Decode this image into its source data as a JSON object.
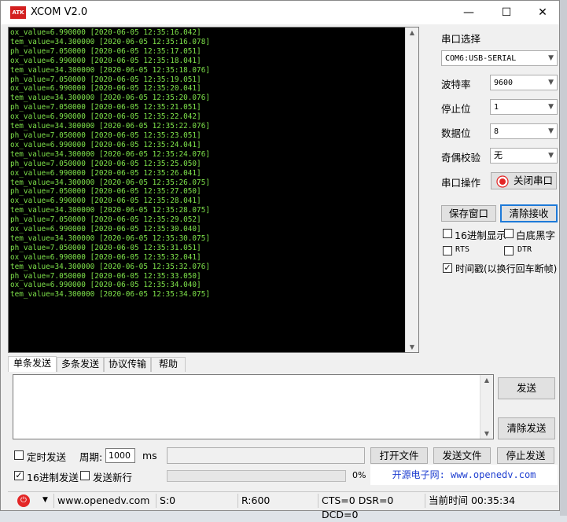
{
  "window": {
    "app_icon_text": "ATK",
    "title": "XCOM V2.0",
    "minimize_glyph": "—",
    "maximize_glyph": "☐",
    "close_glyph": "✕"
  },
  "terminal": {
    "lines": [
      "ox_value=6.990000 [2020-06-05 12:35:16.042]",
      "tem_value=34.300000 [2020-06-05 12:35:16.078]",
      "ph_value=7.050000 [2020-06-05 12:35:17.051]",
      "ox_value=6.990000 [2020-06-05 12:35:18.041]",
      "tem_value=34.300000 [2020-06-05 12:35:18.076]",
      "ph_value=7.050000 [2020-06-05 12:35:19.051]",
      "ox_value=6.990000 [2020-06-05 12:35:20.041]",
      "tem_value=34.300000 [2020-06-05 12:35:20.076]",
      "ph_value=7.050000 [2020-06-05 12:35:21.051]",
      "ox_value=6.990000 [2020-06-05 12:35:22.042]",
      "tem_value=34.300000 [2020-06-05 12:35:22.076]",
      "ph_value=7.050000 [2020-06-05 12:35:23.051]",
      "ox_value=6.990000 [2020-06-05 12:35:24.041]",
      "tem_value=34.300000 [2020-06-05 12:35:24.076]",
      "ph_value=7.050000 [2020-06-05 12:35:25.050]",
      "ox_value=6.990000 [2020-06-05 12:35:26.041]",
      "tem_value=34.300000 [2020-06-05 12:35:26.075]",
      "ph_value=7.050000 [2020-06-05 12:35:27.050]",
      "ox_value=6.990000 [2020-06-05 12:35:28.041]",
      "tem_value=34.300000 [2020-06-05 12:35:28.075]",
      "ph_value=7.050000 [2020-06-05 12:35:29.052]",
      "ox_value=6.990000 [2020-06-05 12:35:30.040]",
      "tem_value=34.300000 [2020-06-05 12:35:30.075]",
      "ph_value=7.050000 [2020-06-05 12:35:31.051]",
      "ox_value=6.990000 [2020-06-05 12:35:32.041]",
      "tem_value=34.300000 [2020-06-05 12:35:32.076]",
      "ph_value=7.050000 [2020-06-05 12:35:33.050]",
      "ox_value=6.990000 [2020-06-05 12:35:34.040]",
      "tem_value=34.300000 [2020-06-05 12:35:34.075]"
    ],
    "text_color": "#7ee24a"
  },
  "settings": {
    "port_label": "串口选择",
    "port_value": "COM6:USB-SERIAL",
    "baud_label": "波特率",
    "baud_value": "9600",
    "stop_label": "停止位",
    "stop_value": "1",
    "data_label": "数据位",
    "data_value": "8",
    "parity_label": "奇偶校验",
    "parity_value": "无",
    "op_label": "串口操作",
    "close_port_label": "关闭串口",
    "save_window_label": "保存窗口",
    "clear_recv_label": "清除接收",
    "hex_display_label": "16进制显示",
    "white_bg_label": "白底黑字",
    "rts_label": "RTS",
    "dtr_label": "DTR",
    "timestamp_label": "时间戳(以换行回车断帧)",
    "hex_display_checked": false,
    "white_bg_checked": false,
    "rts_checked": false,
    "dtr_checked": false,
    "timestamp_checked": true
  },
  "tabs": [
    "单条发送",
    "多条发送",
    "协议传输",
    "帮助"
  ],
  "send": {
    "send_label": "发送",
    "clear_send_label": "清除发送",
    "timed_send_label": "定时发送",
    "period_label": "周期:",
    "period_value": "1000",
    "period_unit": "ms",
    "open_file_label": "打开文件",
    "send_file_label": "发送文件",
    "stop_send_label": "停止发送",
    "hex_send_label": "16进制发送",
    "new_line_label": "发送新行",
    "timed_send_checked": false,
    "hex_send_checked": true,
    "new_line_checked": false,
    "progress_text": "0%",
    "progress_percent": 0,
    "promo_text": "开源电子网: www.openedv.com"
  },
  "status": {
    "url": "www.openedv.com",
    "sent": "S:0",
    "received": "R:600",
    "signals": "CTS=0 DSR=0 DCD=0",
    "time": "当前时间 00:35:34"
  }
}
